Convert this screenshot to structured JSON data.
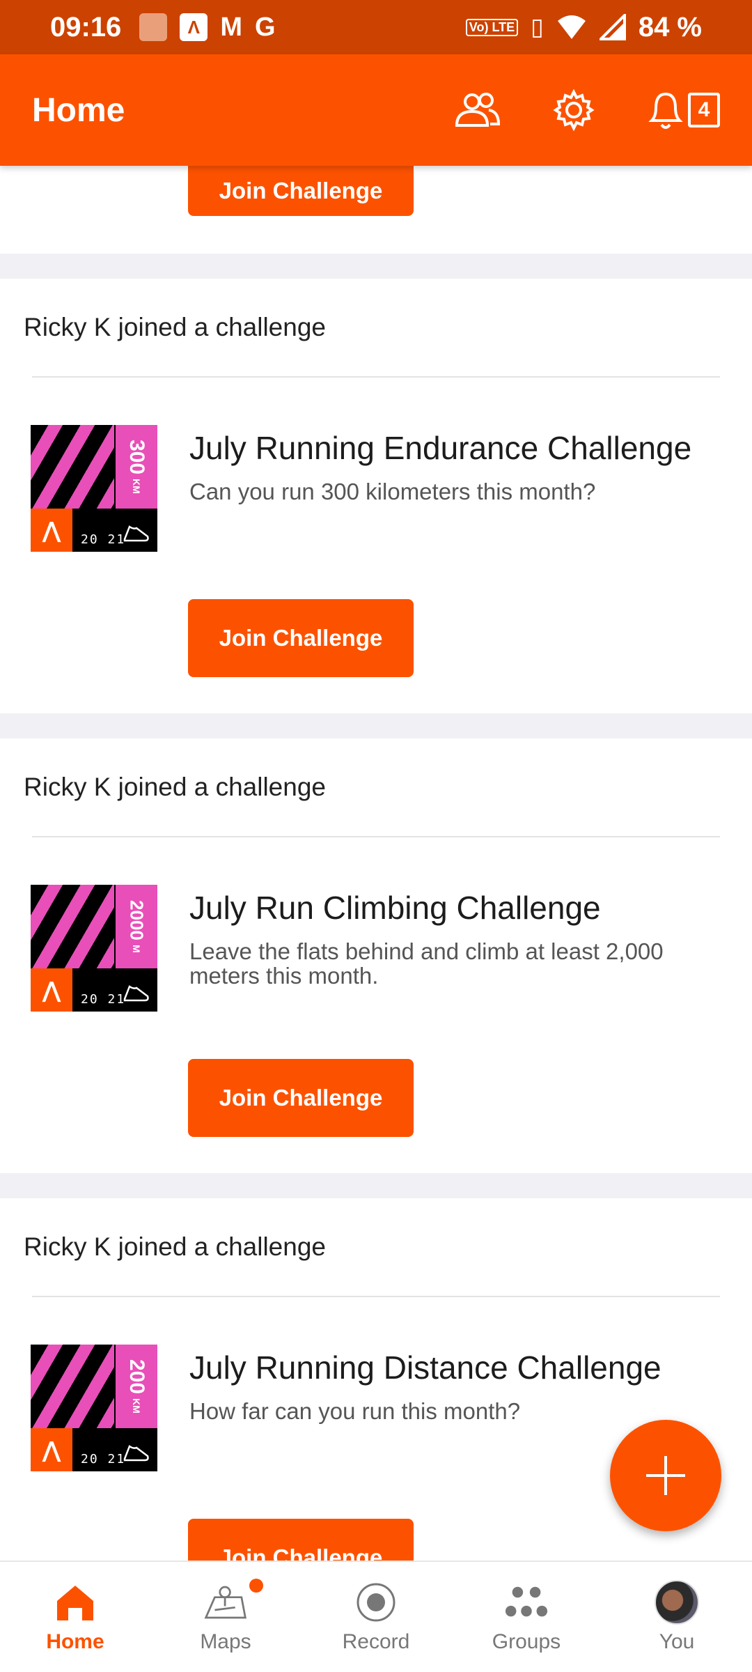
{
  "status_bar": {
    "time": "09:16",
    "notif_icons": [
      "stack-icon",
      "strava-icon",
      "gmail-icon",
      "google-icon"
    ],
    "lte": "Vo) LTE",
    "battery": "84 %"
  },
  "app_bar": {
    "title": "Home",
    "notification_count": "4"
  },
  "feed": {
    "partial_card": {
      "join_label": "Join Challenge"
    },
    "cards": [
      {
        "header": "Ricky K joined a challenge",
        "badge_value": "300",
        "badge_unit": "KM",
        "badge_year": "20 21",
        "title": "July Running Endurance Challenge",
        "description": "Can you run 300 kilometers this month?",
        "join_label": "Join Challenge"
      },
      {
        "header": "Ricky K joined a challenge",
        "badge_value": "2000",
        "badge_unit": "M",
        "badge_year": "20 21",
        "title": "July Run Climbing Challenge",
        "description": "Leave the flats behind and climb at least 2,000 meters this month.",
        "join_label": "Join Challenge"
      },
      {
        "header": "Ricky K joined a challenge",
        "badge_value": "200",
        "badge_unit": "KM",
        "badge_year": "20 21",
        "title": "July Running Distance Challenge",
        "description": "How far can you run this month?",
        "join_label": "Join Challenge"
      }
    ]
  },
  "bottom_nav": [
    {
      "label": "Home",
      "icon": "home-icon",
      "active": true
    },
    {
      "label": "Maps",
      "icon": "map-icon",
      "active": false
    },
    {
      "label": "Record",
      "icon": "record-icon",
      "active": false
    },
    {
      "label": "Groups",
      "icon": "groups-icon",
      "active": false
    },
    {
      "label": "You",
      "icon": "avatar",
      "active": false
    }
  ],
  "colors": {
    "brand": "#fc5200",
    "status_bar": "#cc4200",
    "badge_pink": "#e84fb8"
  }
}
